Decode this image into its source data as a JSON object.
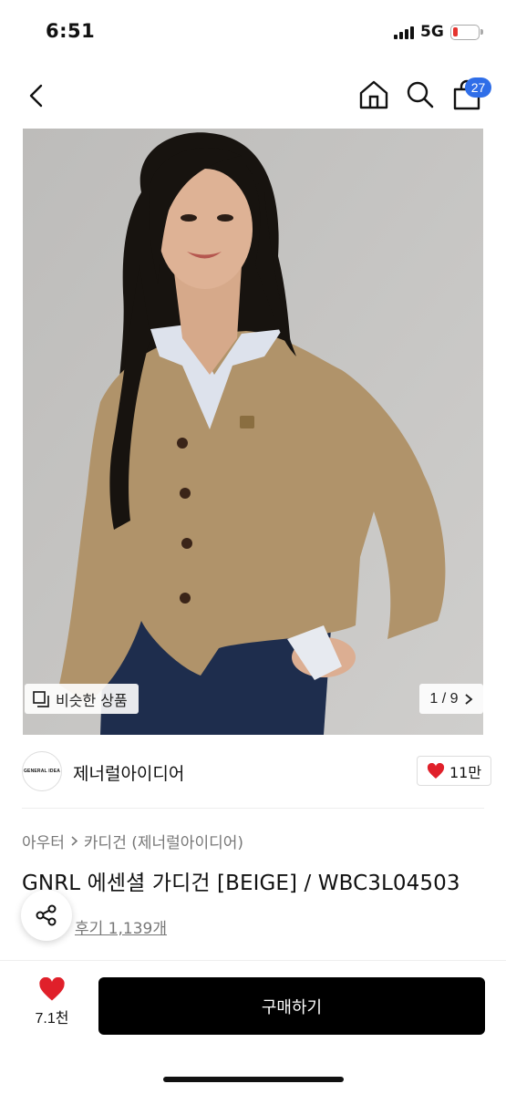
{
  "status_bar": {
    "time": "6:51",
    "network": "5G"
  },
  "header": {
    "cart_count": "27"
  },
  "image": {
    "similar_label": "비슷한 상품",
    "counter": "1 / 9"
  },
  "brand": {
    "logo_text": "GENERAL IDEA",
    "name": "제너럴아이디어",
    "likes": "11만"
  },
  "breadcrumb": {
    "category": "아우터",
    "subcategory": "카디건 (제너럴아이디어)"
  },
  "product": {
    "title": "GNRL 에센셜 가디건 [BEIGE] / WBC3L04503",
    "reviews": "후기 1,139개"
  },
  "bottom_bar": {
    "wish_count": "7.1천",
    "buy_label": "구매하기"
  },
  "colors": {
    "accent_blue": "#2f6ee8",
    "heart_red": "#e0202a",
    "buy_black": "#000000",
    "cardigan_beige": "#b0936a"
  },
  "icons": [
    "back-icon",
    "home-icon",
    "search-icon",
    "shopping-bag-icon",
    "similar-items-icon",
    "chevron-right-icon",
    "heart-icon",
    "share-icon"
  ]
}
